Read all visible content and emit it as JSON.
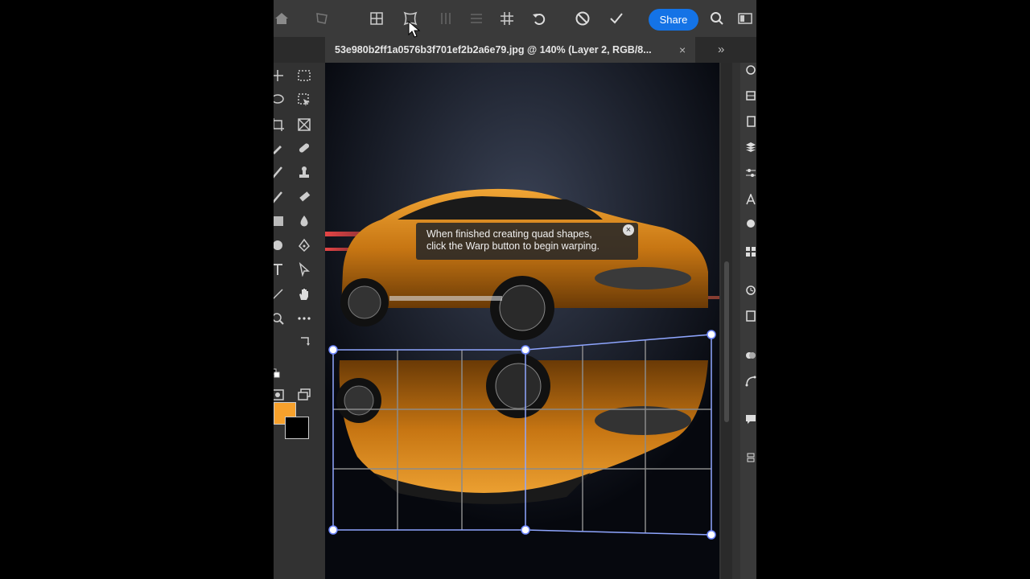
{
  "toolbar_top": {
    "share_label": "Share",
    "icons": [
      "home-icon",
      "transform-icon",
      "quad-split-icon",
      "warp-quad-icon",
      "split-vertical-icon",
      "split-horizontal-icon",
      "grid-icon",
      "undo-icon",
      "cancel-icon",
      "commit-icon",
      "search-icon",
      "workspace-icon"
    ]
  },
  "document": {
    "tab_title": "53e980b2ff1a0576b3f701ef2b2a6e79.jpg @ 140% (Layer 2, RGB/8...",
    "close_glyph": "×",
    "expand_glyph": "»"
  },
  "tools": {
    "fg_color": "#f7a12c",
    "bg_color": "#000000"
  },
  "tooltip": {
    "line1": "When finished creating quad shapes,",
    "line2": "click the Warp button to begin warping.",
    "close_glyph": "×"
  },
  "colors": {
    "accent": "#1473e6",
    "warp_handle": "#8fa6ff",
    "car_body": "#d98a1a"
  }
}
